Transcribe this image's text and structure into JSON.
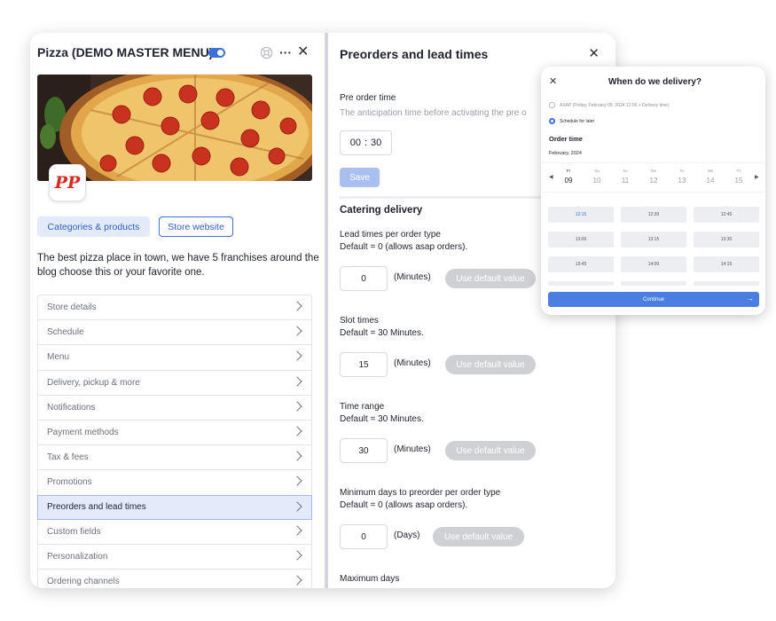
{
  "left_panel": {
    "title": "Pizza (DEMO MASTER MENU)",
    "toggle_on": true,
    "logo_text": "PP",
    "buttons": {
      "categories": "Categories & products",
      "store_website": "Store website"
    },
    "description": "The best pizza place in town, we have 5 franchises around the blog choose this or your favorite one.",
    "menu_items": [
      {
        "label": "Store details"
      },
      {
        "label": "Schedule"
      },
      {
        "label": "Menu"
      },
      {
        "label": "Delivery, pickup & more"
      },
      {
        "label": "Notifications"
      },
      {
        "label": "Payment methods"
      },
      {
        "label": "Tax & fees"
      },
      {
        "label": "Promotions"
      },
      {
        "label": "Preorders and lead times",
        "active": true
      },
      {
        "label": "Custom fields"
      },
      {
        "label": "Personalization"
      },
      {
        "label": "Ordering channels"
      }
    ]
  },
  "right_panel": {
    "title": "Preorders and lead times",
    "pre_order_time": {
      "label": "Pre order time",
      "hint": "The anticipation time before activating the pre o",
      "hours": "00",
      "minutes": "30",
      "save_label": "Save"
    },
    "catering_title": "Catering delivery",
    "settings": [
      {
        "label": "Lead times per order type",
        "default_text": "Default = 0 (allows asap orders).",
        "value": "0",
        "unit": "(Minutes)",
        "button": "Use default value"
      },
      {
        "label": "Slot times",
        "default_text": "Default = 30 Minutes.",
        "value": "15",
        "unit": "(Minutes)",
        "button": "Use default value"
      },
      {
        "label": "Time range",
        "default_text": "Default = 30 Minutes.",
        "value": "30",
        "unit": "(Minutes)",
        "button": "Use default value"
      },
      {
        "label": "Minimum days to preorder per order type",
        "default_text": "Default = 0 (allows asap orders).",
        "value": "0",
        "unit": "(Days)",
        "button": "Use default value"
      }
    ],
    "next_label": "Maximum days"
  },
  "delivery_modal": {
    "title": "When do we delivery?",
    "options": [
      {
        "label": "ASAP (Friday, February 09, 2024 12:06 + Delivery time)",
        "selected": false
      },
      {
        "label": "Schedule for later",
        "selected": true
      }
    ],
    "order_time_label": "Order time",
    "month": "February, 2024",
    "days": [
      {
        "name": "Fr",
        "num": "09",
        "selected": true
      },
      {
        "name": "Sa",
        "num": "10"
      },
      {
        "name": "Su",
        "num": "11"
      },
      {
        "name": "Mo",
        "num": "12"
      },
      {
        "name": "Tu",
        "num": "13"
      },
      {
        "name": "We",
        "num": "14"
      },
      {
        "name": "Th",
        "num": "15"
      }
    ],
    "slots": [
      "12:15",
      "12:30",
      "12:45",
      "13:00",
      "13:15",
      "13:30",
      "13:45",
      "14:00",
      "14:15"
    ],
    "selected_slot": "12:15",
    "continue_label": "Continue",
    "colors": {
      "accent": "#3d6fd9",
      "continue": "#4a7ee0"
    }
  }
}
